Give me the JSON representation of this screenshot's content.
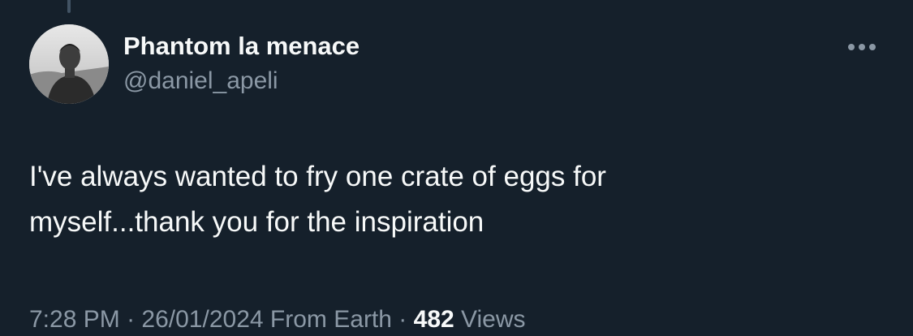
{
  "tweet": {
    "author": {
      "display_name": "Phantom la menace",
      "handle": "@daniel_apeli",
      "avatar_icon": "profile-photo"
    },
    "more_icon": "more-horizontal-icon",
    "text_lines": [
      "I've always wanted to fry one crate of eggs for",
      "myself...thank you for the inspiration"
    ],
    "meta": {
      "time": "7:28 PM",
      "date": "26/01/2024",
      "source": "From Earth",
      "separator": "·",
      "views_count": "482",
      "views_label": "Views"
    }
  },
  "colors": {
    "background": "#15202b",
    "primary_text": "#f7f9f9",
    "secondary_text": "#8b98a5"
  }
}
